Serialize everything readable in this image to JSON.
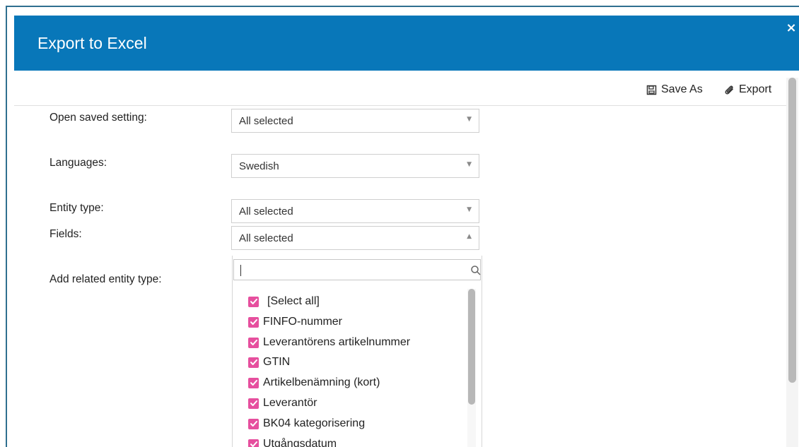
{
  "dialog": {
    "title": "Export to Excel",
    "close_icon": "×"
  },
  "toolbar": {
    "save_as_label": "Save As",
    "export_label": "Export",
    "save_icon_name": "save-icon",
    "export_icon_name": "paperclip-icon"
  },
  "form": {
    "open_saved_setting": {
      "label": "Open saved setting:",
      "value": "All selected"
    },
    "languages": {
      "label": "Languages:",
      "value": "Swedish"
    },
    "entity_type": {
      "label": "Entity type:",
      "value": "All selected"
    },
    "fields": {
      "label": "Fields:",
      "value": "All selected",
      "search_value": "",
      "options": [
        {
          "label": "[Select all]",
          "checked": true
        },
        {
          "label": "FINFO-nummer",
          "checked": true
        },
        {
          "label": "Leverantörens artikelnummer",
          "checked": true
        },
        {
          "label": "GTIN",
          "checked": true
        },
        {
          "label": "Artikelbenämning (kort)",
          "checked": true
        },
        {
          "label": "Leverantör",
          "checked": true
        },
        {
          "label": "BK04 kategorisering",
          "checked": true
        },
        {
          "label": "Utgångsdatum",
          "checked": true
        }
      ]
    },
    "related_entity_type": {
      "label": "Add related entity type:"
    }
  },
  "colors": {
    "header_blue": "#0877b9",
    "checkbox_pink": "#e64f9e"
  }
}
